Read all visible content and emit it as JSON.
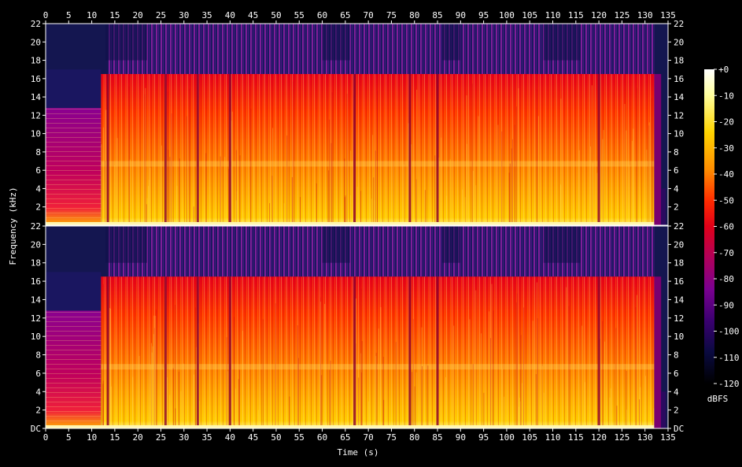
{
  "chart_data": {
    "type": "heatmap",
    "xlabel": "Time (s)",
    "ylabel": "Frequency (kHz)",
    "x_ticks": [
      "0",
      "5",
      "10",
      "15",
      "20",
      "25",
      "30",
      "35",
      "40",
      "45",
      "50",
      "55",
      "60",
      "65",
      "70",
      "75",
      "80",
      "85",
      "90",
      "95",
      "100",
      "105",
      "110",
      "115",
      "120",
      "125",
      "130",
      "135"
    ],
    "xlim": [
      0,
      135
    ],
    "y_ticks_top": [
      "2",
      "4",
      "6",
      "8",
      "10",
      "12",
      "14",
      "16",
      "18",
      "20",
      "22"
    ],
    "y_ticks_bottom": [
      "DC",
      "2",
      "4",
      "6",
      "8",
      "10",
      "12",
      "14",
      "16",
      "18",
      "20",
      "22"
    ],
    "ylim_khz": [
      0,
      22
    ],
    "channels": 2,
    "colorbar": {
      "label": "dBFS",
      "ticks": [
        "+0",
        "-10",
        "-20",
        "-30",
        "-40",
        "-50",
        "-60",
        "-70",
        "-80",
        "-90",
        "-100",
        "-110",
        "-120"
      ],
      "range": [
        -120,
        0
      ]
    },
    "features": {
      "intro_end_s": 12,
      "intro_cutoff_khz": 12.8,
      "main_cutoff_khz": 16.5,
      "music_end_s": 132,
      "dropouts_s": [
        13.5,
        26,
        33,
        40,
        67,
        79,
        85,
        120
      ]
    }
  }
}
